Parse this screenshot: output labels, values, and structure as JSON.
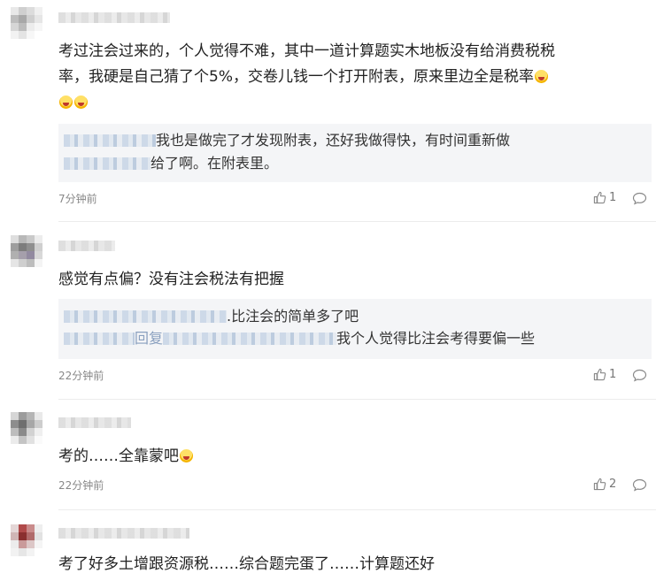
{
  "comments": [
    {
      "text_lines": [
        "考过注会过来的，个人觉得不难，其中一道计算题实木地板没有给消费税税",
        "率，我硬是自己猜了个5%，交卷儿钱一个打开附表，原来里边全是税率"
      ],
      "replies": [
        "我也是做完了才发现附表，还好我做得快，有时间重新做",
        "给了啊。在附表里。"
      ],
      "time": "7分钟前",
      "likes": "1"
    },
    {
      "text": "感觉有点偏？没有注会税法有把握",
      "replies": [
        ".比注会的简单多了吧",
        "我个人觉得比注会考得要偏一些"
      ],
      "reply_prefix": "回复",
      "time": "22分钟前",
      "likes": "1"
    },
    {
      "text": "考的……全靠蒙吧",
      "time": "22分钟前",
      "likes": "2"
    },
    {
      "text": "考了好多土增跟资源税……综合题完蛋了……计算题还好"
    }
  ],
  "icons": {
    "like": "thumbs-up-icon",
    "reply": "speech-bubble-icon",
    "emoji": "laughing-tears-emoji"
  }
}
